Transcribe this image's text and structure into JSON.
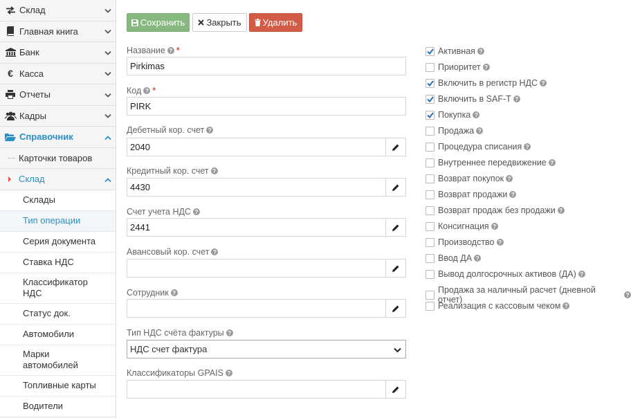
{
  "sidebar": {
    "nav": [
      {
        "label": "Склад",
        "icon": "exchange-icon"
      },
      {
        "label": "Главная книга",
        "icon": "book-icon"
      },
      {
        "label": "Банк",
        "icon": "bank-icon"
      },
      {
        "label": "Касса",
        "icon": "euro-icon"
      },
      {
        "label": "Отчеты",
        "icon": "print-icon"
      },
      {
        "label": "Кадры",
        "icon": "users-icon"
      },
      {
        "label": "Справочник",
        "icon": "folder-open-icon"
      }
    ],
    "sub1": [
      {
        "label": "Карточки товаров"
      },
      {
        "label": "Склад"
      }
    ],
    "sub2": [
      {
        "label": "Склады"
      },
      {
        "label": "Тип операции"
      },
      {
        "label": "Серия документа"
      },
      {
        "label": "Ставка НДС"
      },
      {
        "label": "Классификатор НДС"
      },
      {
        "label": "Статус док."
      },
      {
        "label": "Автомобили"
      },
      {
        "label": "Марки автомобилей"
      },
      {
        "label": "Топливные карты"
      },
      {
        "label": "Водители"
      }
    ]
  },
  "toolbar": {
    "save": "Сохранить",
    "close": "Закрыть",
    "delete": "Удалить"
  },
  "form": {
    "name_label": "Название",
    "name_value": "Pirkimas",
    "code_label": "Код",
    "code_value": "PIRK",
    "debit_label": "Дебетный кор. счет",
    "debit_value": "2040",
    "credit_label": "Кредитный кор. счет",
    "credit_value": "4430",
    "vat_account_label": "Счет учета НДС",
    "vat_account_value": "2441",
    "advance_label": "Авансовый кор. счет",
    "advance_value": "",
    "employee_label": "Сотрудник",
    "employee_value": "",
    "vat_invoice_type_label": "Тип НДС счёта фактуры",
    "vat_invoice_type_value": "НДС счет фактура",
    "gpais_label": "Классификаторы GPAIS",
    "gpais_value": ""
  },
  "checkboxes": [
    {
      "label": "Активная",
      "checked": true
    },
    {
      "label": "Приоритет",
      "checked": false
    },
    {
      "label": "Включить в регистр НДС",
      "checked": true
    },
    {
      "label": "Включить в SAF-T",
      "checked": true
    },
    {
      "label": "Покупка",
      "checked": true
    },
    {
      "label": "Продажа",
      "checked": false
    },
    {
      "label": "Процедура списания",
      "checked": false
    },
    {
      "label": "Внутреннее передвижение",
      "checked": false
    },
    {
      "label": "Возврат покупок",
      "checked": false
    },
    {
      "label": "Возврат продажи",
      "checked": false
    },
    {
      "label": "Возврат продаж без продажи",
      "checked": false
    },
    {
      "label": "Консигнация",
      "checked": false
    },
    {
      "label": "Производство",
      "checked": false
    },
    {
      "label": "Ввод ДА",
      "checked": false
    },
    {
      "label": "Вывод долгосрочных активов (ДА)",
      "checked": false
    },
    {
      "label": "Продажа за наличный расчет (дневной отчет)",
      "checked": false
    },
    {
      "label": "Реализация с кассовым чеком",
      "checked": false
    }
  ],
  "colors": {
    "accent": "#2a8fc5",
    "save": "#87b87f",
    "delete": "#d15b47",
    "required": "#d15b47"
  }
}
